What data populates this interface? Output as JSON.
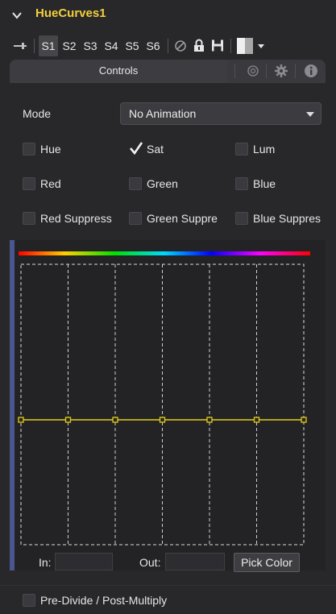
{
  "header": {
    "title": "HueCurves1"
  },
  "toolbar": {
    "slots": [
      "S1",
      "S2",
      "S3",
      "S4",
      "S5",
      "S6"
    ],
    "active_slot": "S1"
  },
  "tabs": {
    "controls_label": "Controls"
  },
  "mode": {
    "label": "Mode",
    "value": "No Animation"
  },
  "checkboxes": {
    "hue": {
      "label": "Hue",
      "checked": false
    },
    "sat": {
      "label": "Sat",
      "checked": true
    },
    "lum": {
      "label": "Lum",
      "checked": false
    },
    "red": {
      "label": "Red",
      "checked": false
    },
    "green": {
      "label": "Green",
      "checked": false
    },
    "blue": {
      "label": "Blue",
      "checked": false
    },
    "red_suppress": {
      "label": "Red Suppress",
      "checked": false
    },
    "green_suppress": {
      "label": "Green Suppre",
      "checked": false
    },
    "blue_suppress": {
      "label": "Blue Suppres",
      "checked": false
    }
  },
  "curve": {
    "color": "#e2cc1e",
    "points": 7
  },
  "io": {
    "in_label": "In:",
    "in_value": "",
    "out_label": "Out:",
    "out_value": "",
    "pick_color_label": "Pick Color"
  },
  "bottom": {
    "pre_divide": {
      "label": "Pre-Divide / Post-Multiply",
      "checked": false
    }
  },
  "colors": {
    "title": "#f3cf3b",
    "accent_bar": "#4a5690",
    "curve": "#e2cc1e"
  }
}
